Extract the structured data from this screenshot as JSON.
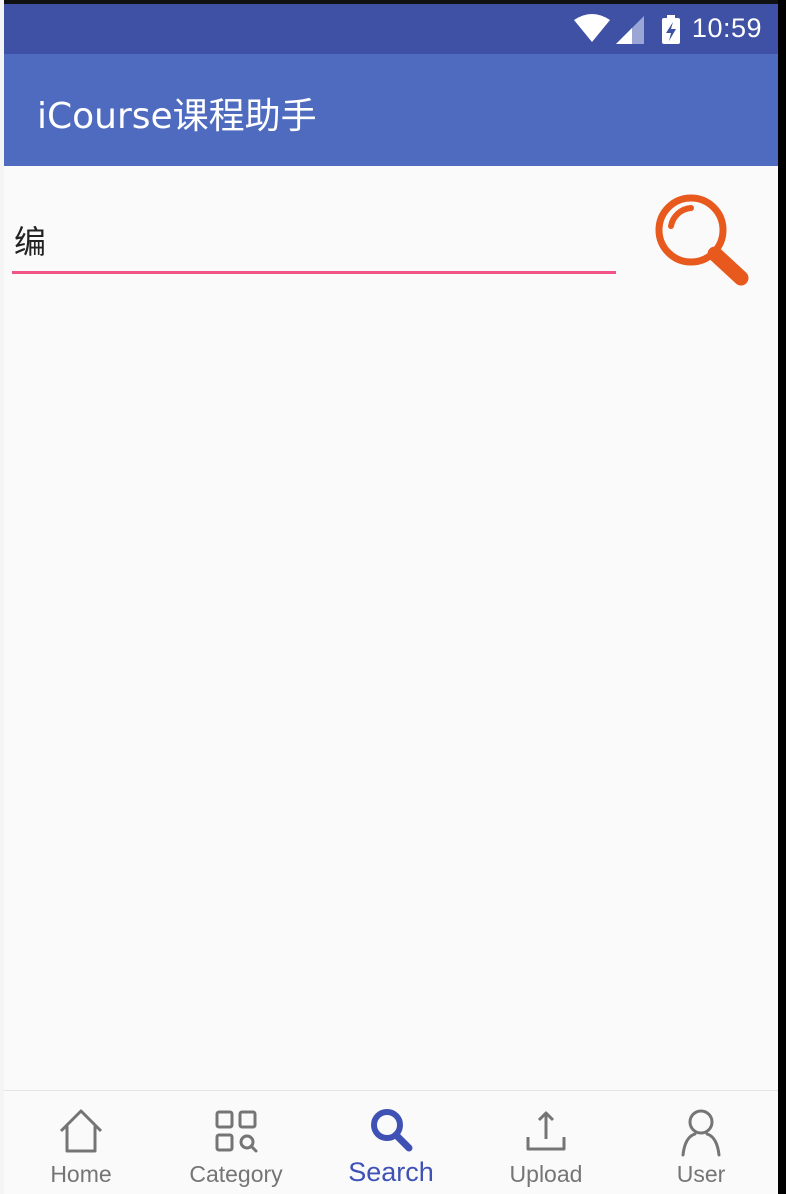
{
  "status_bar": {
    "time": "10:59",
    "icons": [
      "wifi-icon",
      "signal-icon",
      "battery-charging-icon"
    ]
  },
  "app_bar": {
    "title": "iCourse课程助手"
  },
  "search": {
    "value": "编",
    "button_icon": "search-icon",
    "accent_color": "#f25585",
    "button_color": "#e8591d"
  },
  "bottom_nav": {
    "items": [
      {
        "label": "Home",
        "icon": "home-icon",
        "active": false
      },
      {
        "label": "Category",
        "icon": "category-icon",
        "active": false
      },
      {
        "label": "Search",
        "icon": "search-icon",
        "active": true
      },
      {
        "label": "Upload",
        "icon": "upload-icon",
        "active": false
      },
      {
        "label": "User",
        "icon": "user-icon",
        "active": false
      }
    ],
    "active_color": "#3f51b5",
    "inactive_color": "#757575"
  },
  "colors": {
    "status_bar": "#3f51a5",
    "app_bar": "#4f6bbf",
    "background": "#fafafa"
  }
}
